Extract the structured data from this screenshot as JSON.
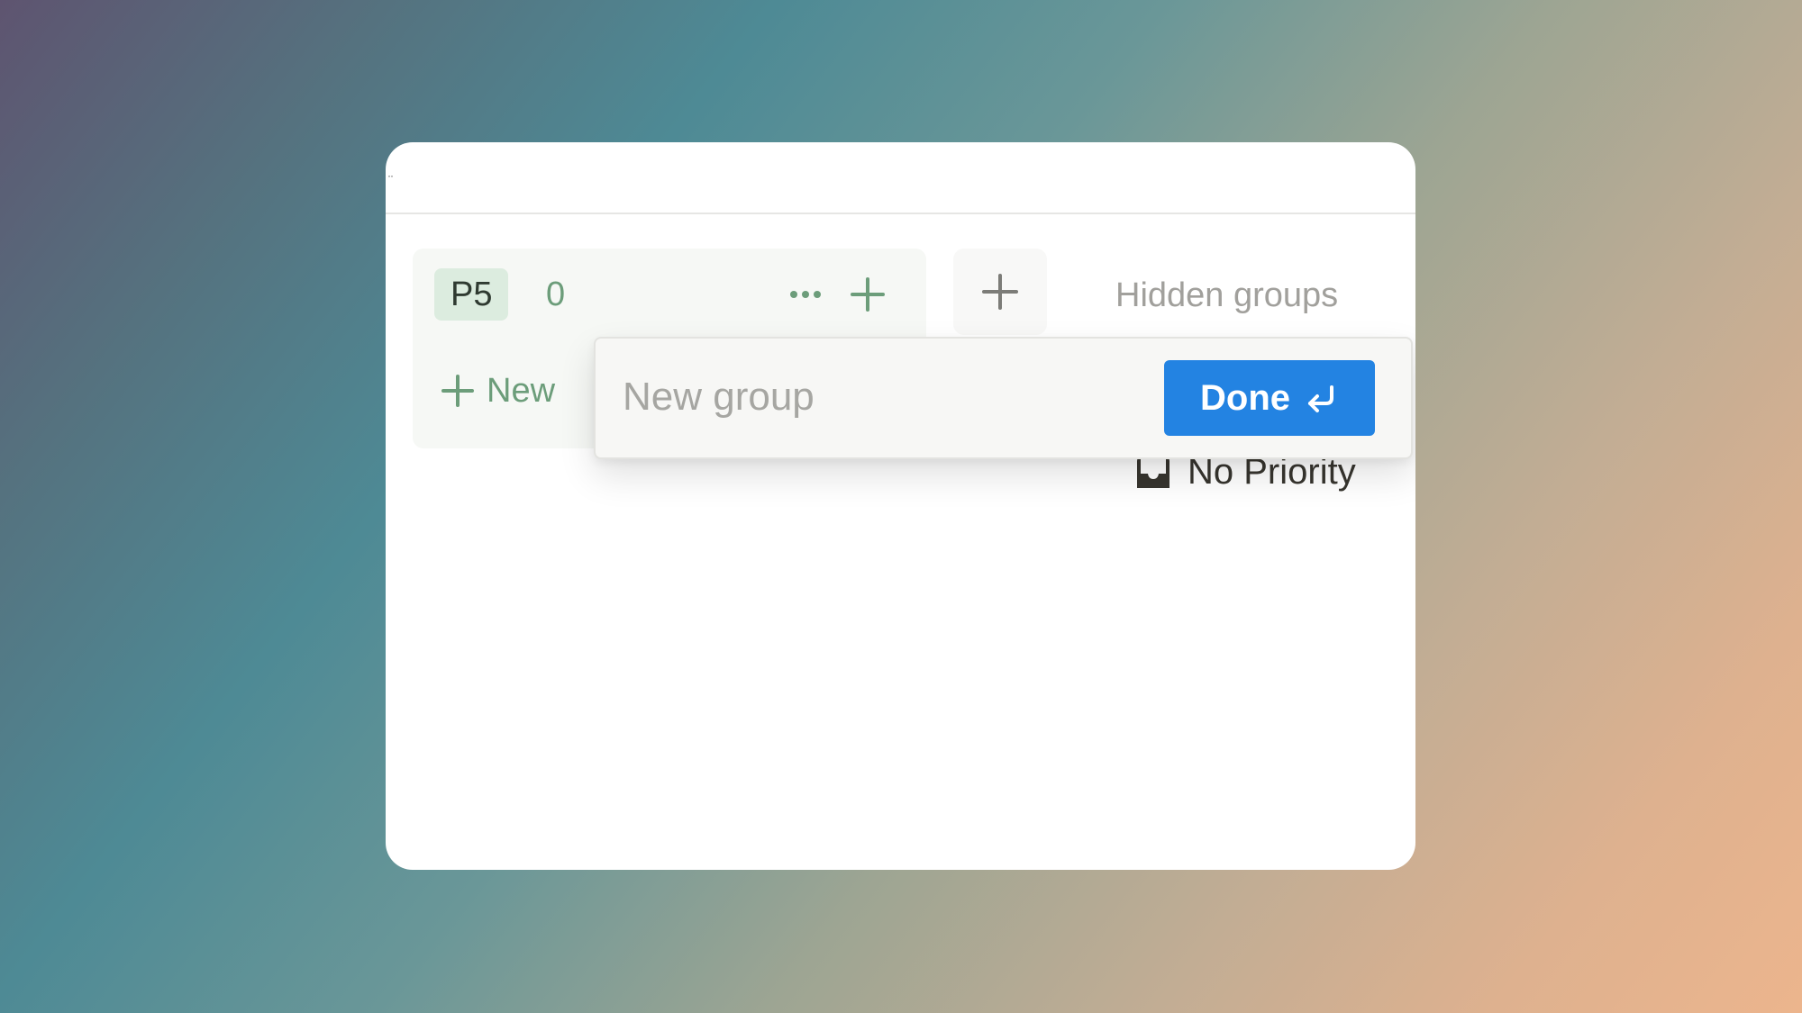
{
  "board": {
    "group": {
      "label": "P5",
      "count": "0",
      "new_label": "New"
    },
    "hidden_groups_label": "Hidden groups",
    "no_priority_label": "No Priority"
  },
  "new_group_popover": {
    "placeholder": "New group",
    "value": "",
    "done_label": "Done"
  },
  "colors": {
    "accent_blue": "#2383e2",
    "group_green": "#6c9d7a",
    "group_pill_bg": "#dcecdf"
  },
  "icons": {
    "more": "more-horizontal-icon",
    "add": "plus-icon",
    "enter": "enter-return-icon",
    "priority": "inbox-tray-icon"
  }
}
